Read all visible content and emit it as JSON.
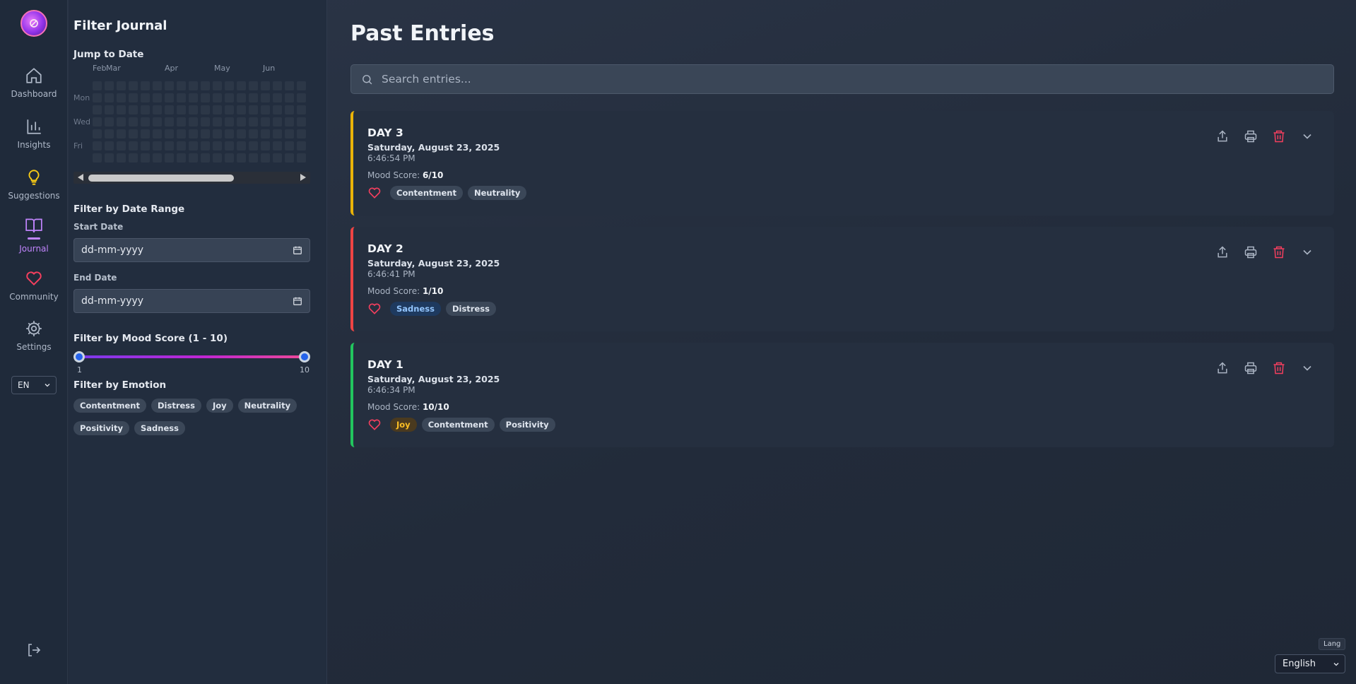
{
  "nav": {
    "items": [
      {
        "label": "Dashboard",
        "icon": "home-icon"
      },
      {
        "label": "Insights",
        "icon": "bar-chart-icon"
      },
      {
        "label": "Suggestions",
        "icon": "lightbulb-icon"
      },
      {
        "label": "Journal",
        "icon": "book-open-icon",
        "active": true
      },
      {
        "label": "Community",
        "icon": "heart-icon"
      },
      {
        "label": "Settings",
        "icon": "gear-icon"
      }
    ],
    "language": "EN"
  },
  "filters": {
    "title": "Filter Journal",
    "jump_title": "Jump to Date",
    "months": [
      "Feb",
      "Mar",
      "Apr",
      "May",
      "Jun"
    ],
    "weekdays": [
      "Mon",
      "Wed",
      "Fri"
    ],
    "date_range_title": "Filter by Date Range",
    "start_label": "Start Date",
    "start_placeholder": "dd-mm-yyyy",
    "end_label": "End Date",
    "end_placeholder": "dd-mm-yyyy",
    "mood_title": "Filter by Mood Score (1 - 10)",
    "mood_min": "1",
    "mood_max": "10",
    "emotion_title": "Filter by Emotion",
    "emotions": [
      "Contentment",
      "Distress",
      "Joy",
      "Neutrality",
      "Positivity",
      "Sadness"
    ]
  },
  "main": {
    "title": "Past Entries",
    "search_placeholder": "Search entries...",
    "mood_label": "Mood Score:",
    "entries": [
      {
        "day": "DAY 3",
        "date": "Saturday, August 23, 2025",
        "time": "6:46:54 PM",
        "mood": "6/10",
        "accent": "#eab308",
        "tags": [
          "Contentment",
          "Neutrality"
        ]
      },
      {
        "day": "DAY 2",
        "date": "Saturday, August 23, 2025",
        "time": "6:46:41 PM",
        "mood": "1/10",
        "accent": "#ef4444",
        "tags": [
          "Sadness",
          "Distress"
        ]
      },
      {
        "day": "DAY 1",
        "date": "Saturday, August 23, 2025",
        "time": "6:46:34 PM",
        "mood": "10/10",
        "accent": "#22c55e",
        "tags": [
          "Joy",
          "Contentment",
          "Positivity"
        ]
      }
    ]
  },
  "footer": {
    "lang_tip": "Lang",
    "lang_value": "English"
  }
}
